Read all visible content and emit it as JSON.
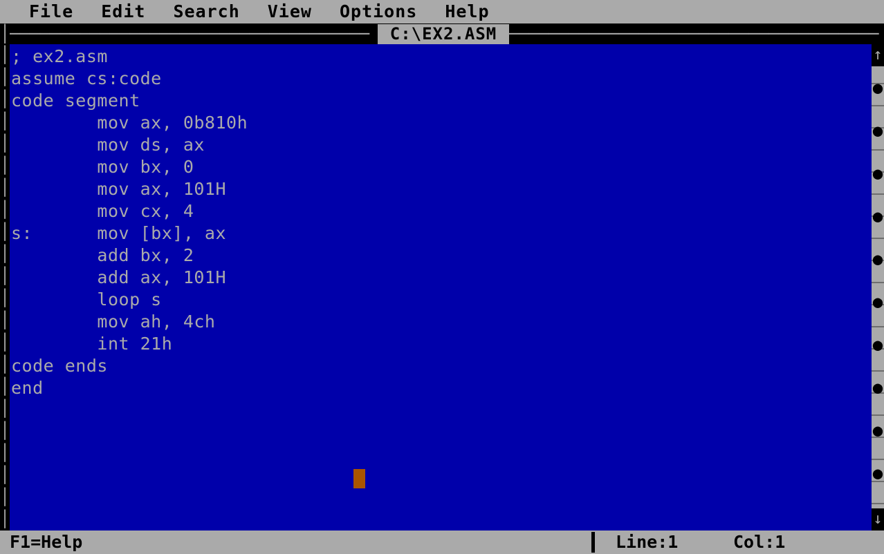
{
  "menubar": {
    "items": [
      {
        "label": "File"
      },
      {
        "label": "Edit"
      },
      {
        "label": "Search"
      },
      {
        "label": "View"
      },
      {
        "label": "Options"
      },
      {
        "label": "Help"
      }
    ]
  },
  "window": {
    "title": "C:\\EX2.ASM",
    "border_corner_glyph": "│",
    "border_dash_left": "────────────────────────────────────",
    "border_dash_right": "─────────────────────────────────────",
    "left_border_glyphs": "│\n│\n│\n│\n│\n│\n│\n│\n│\n│\n│\n│\n│\n│\n│\n│\n│\n│\n│\n│\n│\n│"
  },
  "editor": {
    "filename": "ex2.asm",
    "background_color": "#0000aa",
    "text_color": "#aaaaaa",
    "cursor_color": "#aa5500",
    "lines": [
      "; ex2.asm",
      "assume cs:code",
      "code segment",
      "        mov ax, 0b810h",
      "        mov ds, ax",
      "        mov bx, 0",
      "        mov ax, 101H",
      "        mov cx, 4",
      "s:      mov [bx], ax",
      "        add bx, 2",
      "        add ax, 101H",
      "        loop s",
      "        mov ah, 4ch",
      "        int 21h",
      "code ends",
      "end"
    ],
    "source_text": "; ex2.asm\nassume cs:code\ncode segment\n        mov ax, 0b810h\n        mov ds, ax\n        mov bx, 0\n        mov ax, 101H\n        mov cx, 4\ns:      mov [bx], ax\n        add bx, 2\n        add ax, 101H\n        loop s\n        mov ah, 4ch\n        int 21h\ncode ends\nend"
  },
  "scrollbar": {
    "up_arrow_glyph": "↑",
    "down_arrow_glyph": "↓",
    "track_dots": "●\n●\n●\n●\n●\n●\n●\n●\n●\n●"
  },
  "statusbar": {
    "help_hint": "F1=Help",
    "line_label": "Line:1",
    "col_label": "Col:1"
  },
  "theme": {
    "chrome_gray": "#aaaaaa",
    "editor_blue": "#0000aa",
    "cursor_orange": "#aa5500",
    "black": "#000000"
  }
}
